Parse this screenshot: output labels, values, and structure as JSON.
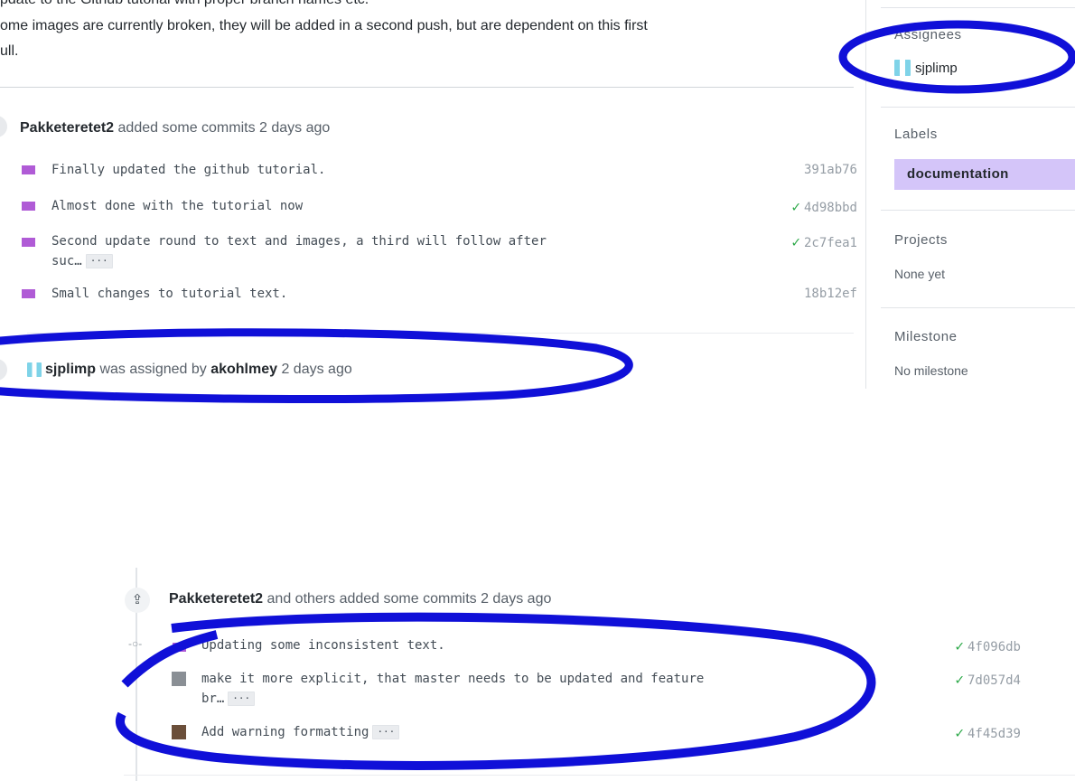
{
  "description": {
    "line1": "pdate to the Github tutorial with proper branch names etc.",
    "line2": "ome images are currently broken, they will be added in a second push, but are dependent on this first",
    "line3": "ull."
  },
  "sidebar": {
    "assignees_heading": "Assignees",
    "assignee_name": "sjplimp",
    "labels_heading": "Labels",
    "label": "documentation",
    "projects_heading": "Projects",
    "projects_value": "None yet",
    "milestone_heading": "Milestone",
    "milestone_value": "No milestone"
  },
  "event1": {
    "author": "Pakketeretet2",
    "action": " added some commits 2 days ago",
    "commits": [
      {
        "message": "Finally updated the github tutorial.",
        "ellipsis": false,
        "sha": "391ab76",
        "checked": false
      },
      {
        "message": "Almost done with the tutorial now",
        "ellipsis": false,
        "sha": "4d98bbd",
        "checked": true
      },
      {
        "message": "Second update round to text and images, a third will follow after",
        "message2": "suc…",
        "ellipsis": true,
        "sha": "2c7fea1",
        "checked": true
      },
      {
        "message": "Small changes to tutorial text.",
        "ellipsis": false,
        "sha": "18b12ef",
        "checked": false
      }
    ]
  },
  "event2": {
    "assignee": "sjplimp",
    "middle": " was assigned by ",
    "assigner": "akohlmey",
    "time": " 2 days ago"
  },
  "event3": {
    "author": "Pakketeretet2",
    "action": " and others added some commits 2 days ago",
    "commits": [
      {
        "message": "Updating some inconsistent text.",
        "sha": "4f096db",
        "checked": true
      },
      {
        "message": "make it more explicit, that master needs to be updated and feature",
        "message2": "br…",
        "sha": "7d057d4",
        "checked": true
      },
      {
        "message": "Add warning formatting",
        "sha": "4f45d39",
        "checked": true
      }
    ]
  },
  "ellipsis_label": "···",
  "check_glyph": "✓",
  "colors": {
    "annotation": "#1010d8",
    "label_bg": "#d4c5f9",
    "check": "#28a745"
  }
}
